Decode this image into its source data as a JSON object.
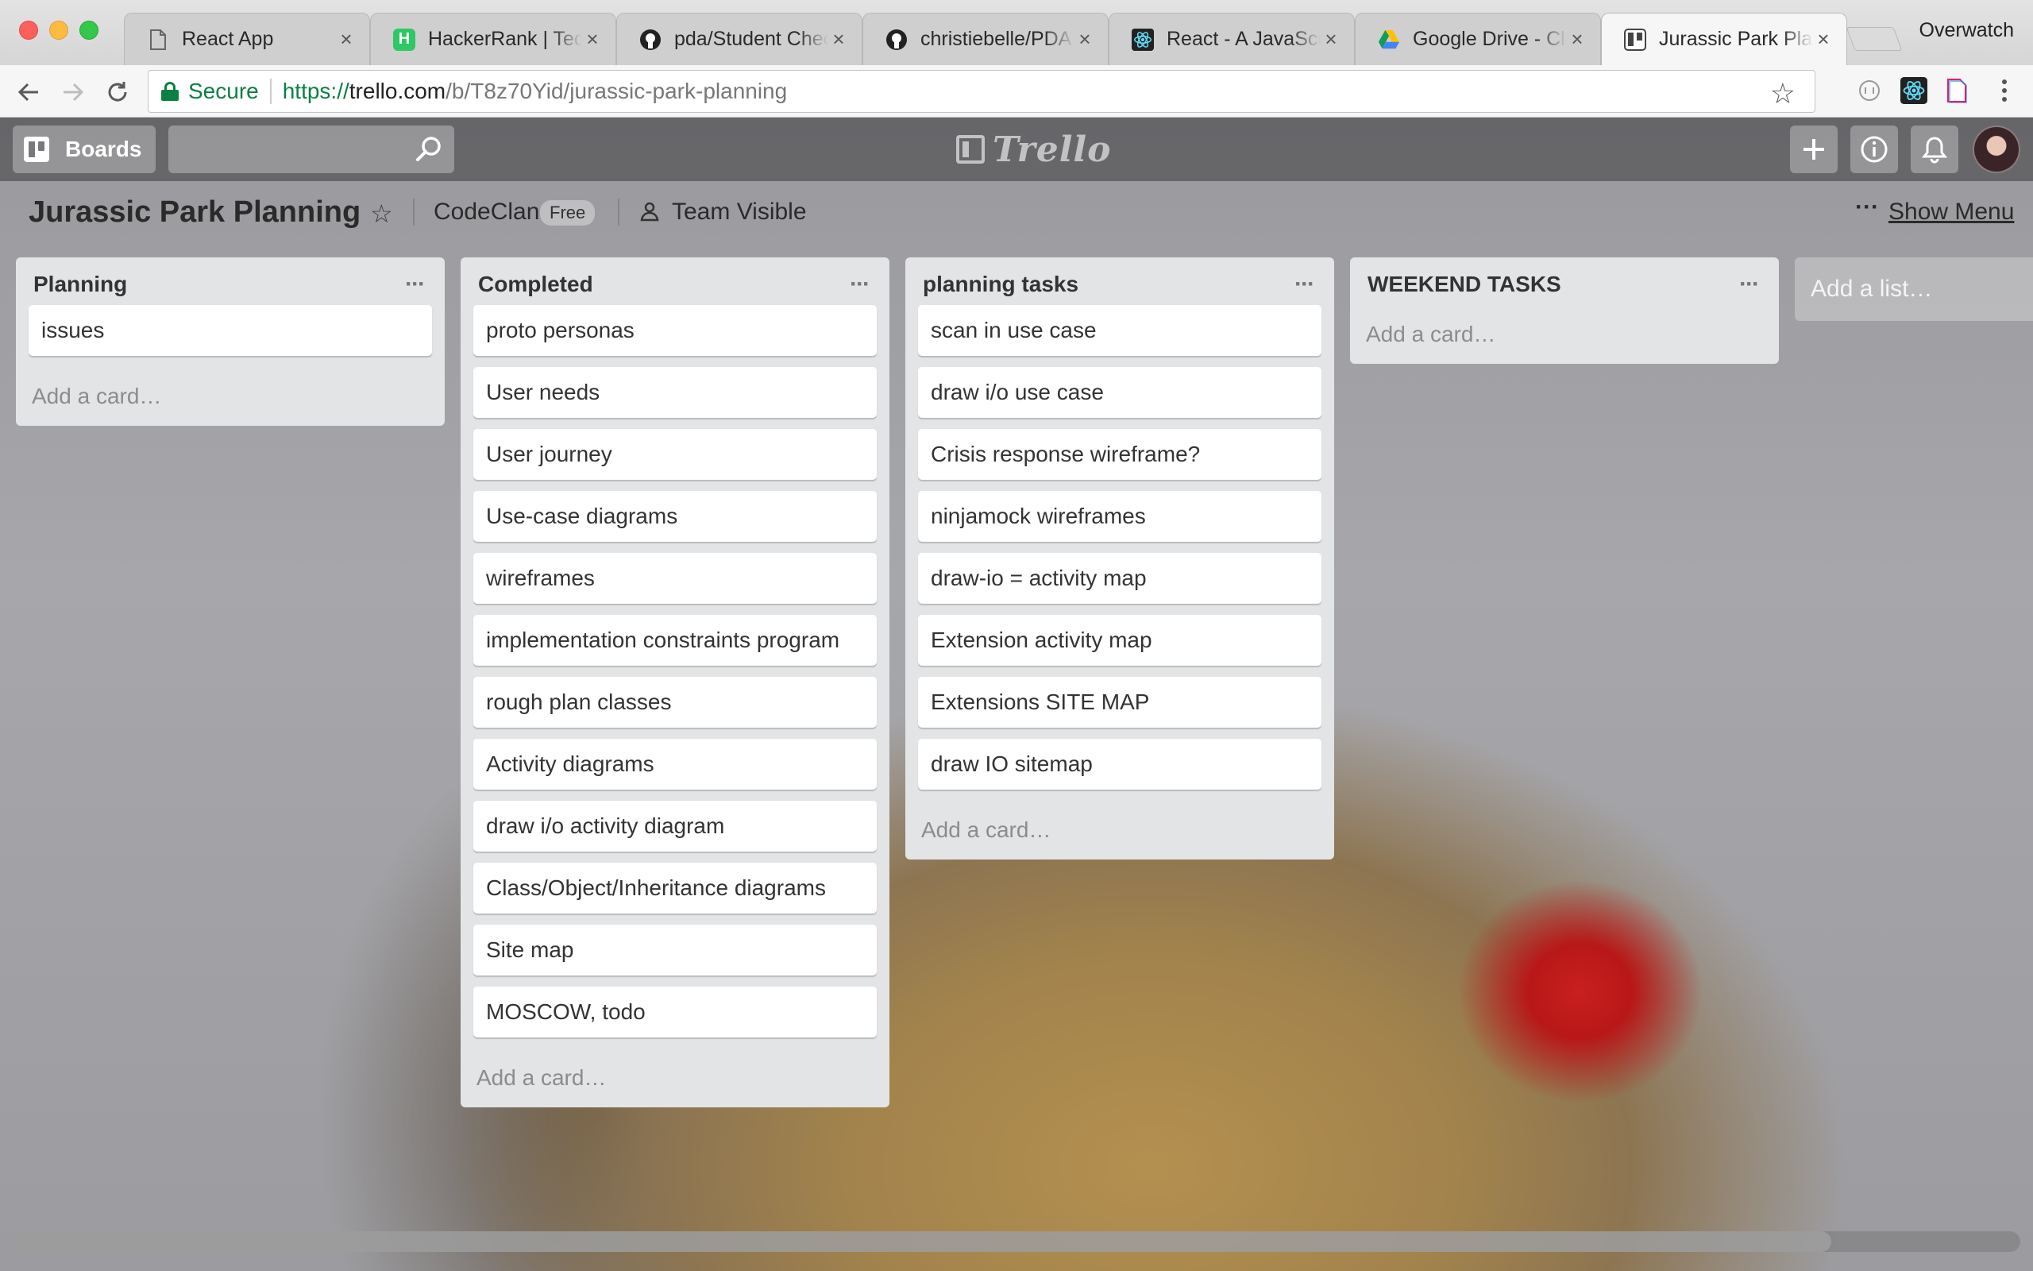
{
  "browser": {
    "tabs": [
      {
        "title": "React App",
        "icon": "document-icon"
      },
      {
        "title": "HackerRank | Tech",
        "icon": "hackerrank-icon"
      },
      {
        "title": "pda/Student Check",
        "icon": "github-icon"
      },
      {
        "title": "christiebelle/PDA",
        "icon": "github-icon"
      },
      {
        "title": "React - A JavaScript",
        "icon": "react-icon"
      },
      {
        "title": "Google Drive - Cloud",
        "icon": "google-drive-icon"
      },
      {
        "title": "Jurassic Park Plan",
        "icon": "trello-icon"
      }
    ],
    "active_tab": 6,
    "profile_name": "Overwatch",
    "omnibox": {
      "secure_label": "Secure",
      "url_scheme": "https://",
      "url_host": "trello.com",
      "url_path": "/b/T8z70Yid/jurassic-park-planning"
    }
  },
  "trello": {
    "header": {
      "boards_label": "Boards",
      "search_placeholder": "",
      "logo_text": "Trello"
    },
    "board": {
      "title": "Jurassic Park Planning",
      "org_name": "CodeClan",
      "org_badge": "Free",
      "visibility": "Team Visible",
      "show_menu_label": "Show Menu"
    },
    "lists": [
      {
        "title": "Planning",
        "cards": [
          "issues"
        ],
        "add_card_label": "Add a card…"
      },
      {
        "title": "Completed",
        "cards": [
          "proto personas",
          "User needs",
          "User journey",
          "Use-case diagrams",
          "wireframes",
          "implementation constraints program",
          "rough plan classes",
          "Activity diagrams",
          "draw i/o activity diagram",
          "Class/Object/Inheritance diagrams",
          "Site map",
          "MOSCOW, todo"
        ],
        "add_card_label": "Add a card…"
      },
      {
        "title": "planning tasks",
        "cards": [
          "scan in use case",
          "draw i/o use case",
          "Crisis response wireframe?",
          "ninjamock wireframes",
          "draw-io = activity map",
          "Extension activity map",
          "Extensions SITE MAP",
          "draw IO sitemap"
        ],
        "add_card_label": "Add a card…"
      },
      {
        "title": "WEEKEND TASKS",
        "cards": [],
        "add_card_label": "Add a card…"
      }
    ],
    "add_list_label": "Add a list…"
  },
  "colors": {
    "secure_green": "#0b8043",
    "list_bg": "#e2e4e6",
    "card_bg": "#ffffff"
  }
}
